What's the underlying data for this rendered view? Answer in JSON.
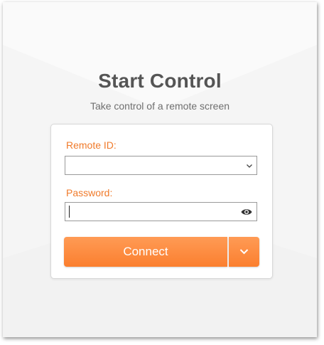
{
  "header": {
    "title": "Start Control",
    "subtitle": "Take control of a remote screen"
  },
  "form": {
    "remote_id_label": "Remote ID:",
    "remote_id_value": "",
    "password_label": "Password:",
    "password_value": ""
  },
  "actions": {
    "connect_label": "Connect"
  },
  "colors": {
    "accent": "#f07a2a",
    "button_top": "#ff9b55",
    "button_bottom": "#fb7f2f",
    "title_text": "#555555",
    "window_bg": "#f5f5f5"
  },
  "icons": {
    "remote_id_dropdown": "chevron-down-icon",
    "password_toggle": "eye-icon",
    "connect_options": "chevron-down-icon"
  }
}
